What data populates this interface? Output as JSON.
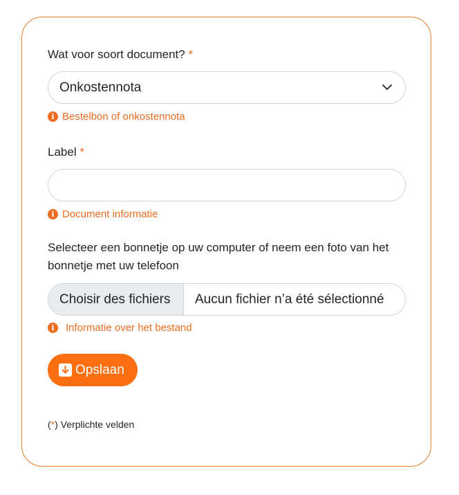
{
  "form": {
    "doctype": {
      "label": "Wat voor soort document?",
      "required_mark": "*",
      "value": "Onkostennota",
      "hint": "Bestelbon of onkostennota"
    },
    "label_field": {
      "label": "Label",
      "required_mark": "*",
      "value": "",
      "hint": "Document informatie"
    },
    "upload": {
      "description": "Selecteer een bonnetje op uw computer of neem een foto van het bonnetje met uw telefoon",
      "button_label": "Choisir des fichiers",
      "status": "Aucun fichier n’a été sélectionné",
      "hint": "Informatie over het bestand"
    },
    "save_label": "Opslaan",
    "footnote": {
      "open": "(",
      "mark": "*",
      "close": ")",
      "text": " Verplichte velden"
    }
  },
  "icons": {
    "info": "info-icon",
    "chevron": "chevron-down-icon",
    "save": "download-save-icon"
  },
  "colors": {
    "accent": "#ef6c1f",
    "button": "#fc6f10",
    "card_border": "#e87d2c",
    "input_border": "#ced4da",
    "file_button_bg": "#e9ecef"
  }
}
